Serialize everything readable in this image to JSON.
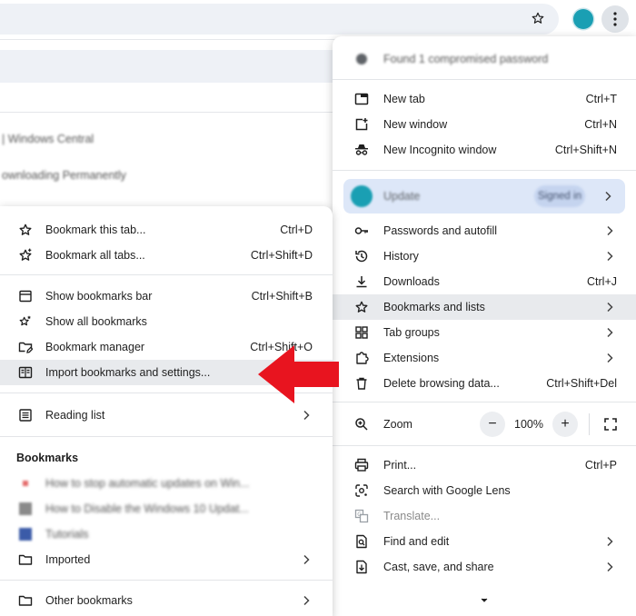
{
  "colors": {
    "accent_red": "#e8141f",
    "avatar_teal": "#1a9fb3",
    "highlight_bg": "#e8eaed",
    "profile_bg": "#dde7f8"
  },
  "background": {
    "tab_text_1": "| Windows Central",
    "tab_text_2": "ownloading Permanently"
  },
  "main_menu": {
    "password_notice": "Found 1 compromised password",
    "items_group1": [
      {
        "label": "New tab",
        "shortcut": "Ctrl+T",
        "icon": "new-tab-icon"
      },
      {
        "label": "New window",
        "shortcut": "Ctrl+N",
        "icon": "new-window-icon"
      },
      {
        "label": "New Incognito window",
        "shortcut": "Ctrl+Shift+N",
        "icon": "incognito-icon"
      }
    ],
    "profile": {
      "name": "Update",
      "status": "Signed in"
    },
    "items_group2": [
      {
        "label": "Passwords and autofill",
        "icon": "key-icon"
      },
      {
        "label": "History",
        "icon": "history-icon"
      },
      {
        "label": "Downloads",
        "shortcut": "Ctrl+J",
        "icon": "download-icon"
      },
      {
        "label": "Bookmarks and lists",
        "icon": "star-icon"
      },
      {
        "label": "Tab groups",
        "icon": "tab-groups-icon"
      },
      {
        "label": "Extensions",
        "icon": "extensions-icon"
      },
      {
        "label": "Delete browsing data...",
        "shortcut": "Ctrl+Shift+Del",
        "icon": "trash-icon"
      }
    ],
    "zoom": {
      "label": "Zoom",
      "minus": "−",
      "value": "100%",
      "plus": "+"
    },
    "items_group3": [
      {
        "label": "Print...",
        "shortcut": "Ctrl+P",
        "icon": "print-icon"
      },
      {
        "label": "Search with Google Lens",
        "icon": "lens-icon"
      },
      {
        "label": "Translate...",
        "icon": "translate-icon"
      },
      {
        "label": "Find and edit",
        "icon": "find-icon"
      },
      {
        "label": "Cast, save, and share",
        "icon": "cast-icon"
      }
    ]
  },
  "bookmarks_menu": {
    "group1": [
      {
        "label": "Bookmark this tab...",
        "shortcut": "Ctrl+D"
      },
      {
        "label": "Bookmark all tabs...",
        "shortcut": "Ctrl+Shift+D"
      }
    ],
    "group2": [
      {
        "label": "Show bookmarks bar",
        "shortcut": "Ctrl+Shift+B"
      },
      {
        "label": "Show all bookmarks"
      },
      {
        "label": "Bookmark manager",
        "shortcut": "Ctrl+Shift+O"
      },
      {
        "label": "Import bookmarks and settings..."
      }
    ],
    "reading_list": "Reading list",
    "section_title": "Bookmarks",
    "bookmarks": [
      {
        "label": "How to stop automatic updates on Win..."
      },
      {
        "label": "How to Disable the Windows 10 Updat..."
      },
      {
        "label": "Tutorials"
      }
    ],
    "imported": "Imported",
    "other_bookmarks": "Other bookmarks"
  }
}
